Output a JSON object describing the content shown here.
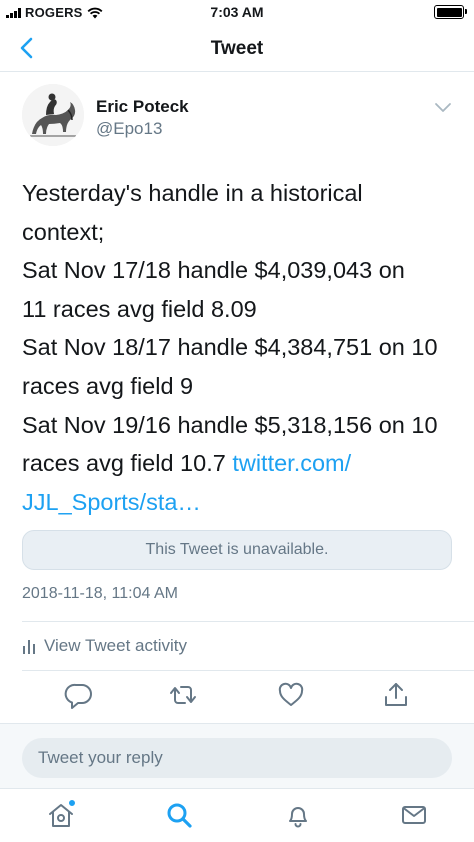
{
  "status_bar": {
    "carrier": "ROGERS",
    "time": "7:03 AM"
  },
  "nav": {
    "title": "Tweet"
  },
  "author": {
    "name": "Eric Poteck",
    "handle": "@Epo13"
  },
  "tweet": {
    "lines": [
      "Yesterday's handle in a historical",
      "context;",
      "Sat Nov 17/18 handle $4,039,043 on",
      "11 races avg field 8.09",
      "Sat Nov 18/17 handle $4,384,751 on 10",
      "races avg field 9",
      "Sat Nov 19/16 handle $5,318,156 on 10",
      "races avg field 10.7 "
    ],
    "link_part1": "twitter.com/",
    "link_part2": "JJL_Sports/sta…",
    "quote_unavailable": "This Tweet is unavailable.",
    "timestamp": "2018-11-18, 11:04 AM",
    "activity_label": "View Tweet activity"
  },
  "actions": {
    "icons": [
      "reply-icon",
      "retweet-icon",
      "like-icon",
      "share-icon"
    ]
  },
  "reply": {
    "placeholder": "Tweet your reply"
  },
  "tab_bar": {
    "icons": [
      "home-icon",
      "search-icon",
      "notifications-icon",
      "messages-icon"
    ]
  },
  "colors": {
    "accent": "#1da1f2",
    "secondary_text": "#657786",
    "border": "#e1e8ed"
  }
}
